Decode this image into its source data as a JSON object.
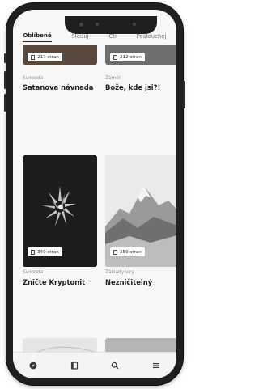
{
  "tabs": [
    {
      "label": "Oblíbené",
      "active": true
    },
    {
      "label": "Sleduj",
      "active": false
    },
    {
      "label": "Čti",
      "active": false
    },
    {
      "label": "Poslouchej",
      "active": false
    }
  ],
  "books": [
    {
      "pages": "217 stran",
      "genre": "Svoboda",
      "title": "Satanova návnada"
    },
    {
      "pages": "212 stran",
      "genre": "Záměr",
      "title": "Bože, kde jsi?!"
    },
    {
      "pages": "340 stran",
      "genre": "Svoboda",
      "title": "Zničte Kryptonit"
    },
    {
      "pages": "259 stran",
      "genre": "Základy víry",
      "title": "Nezničitelný"
    }
  ],
  "bottom_nav": [
    {
      "icon": "compass-icon"
    },
    {
      "icon": "book-icon"
    },
    {
      "icon": "search-icon"
    },
    {
      "icon": "menu-icon"
    }
  ]
}
